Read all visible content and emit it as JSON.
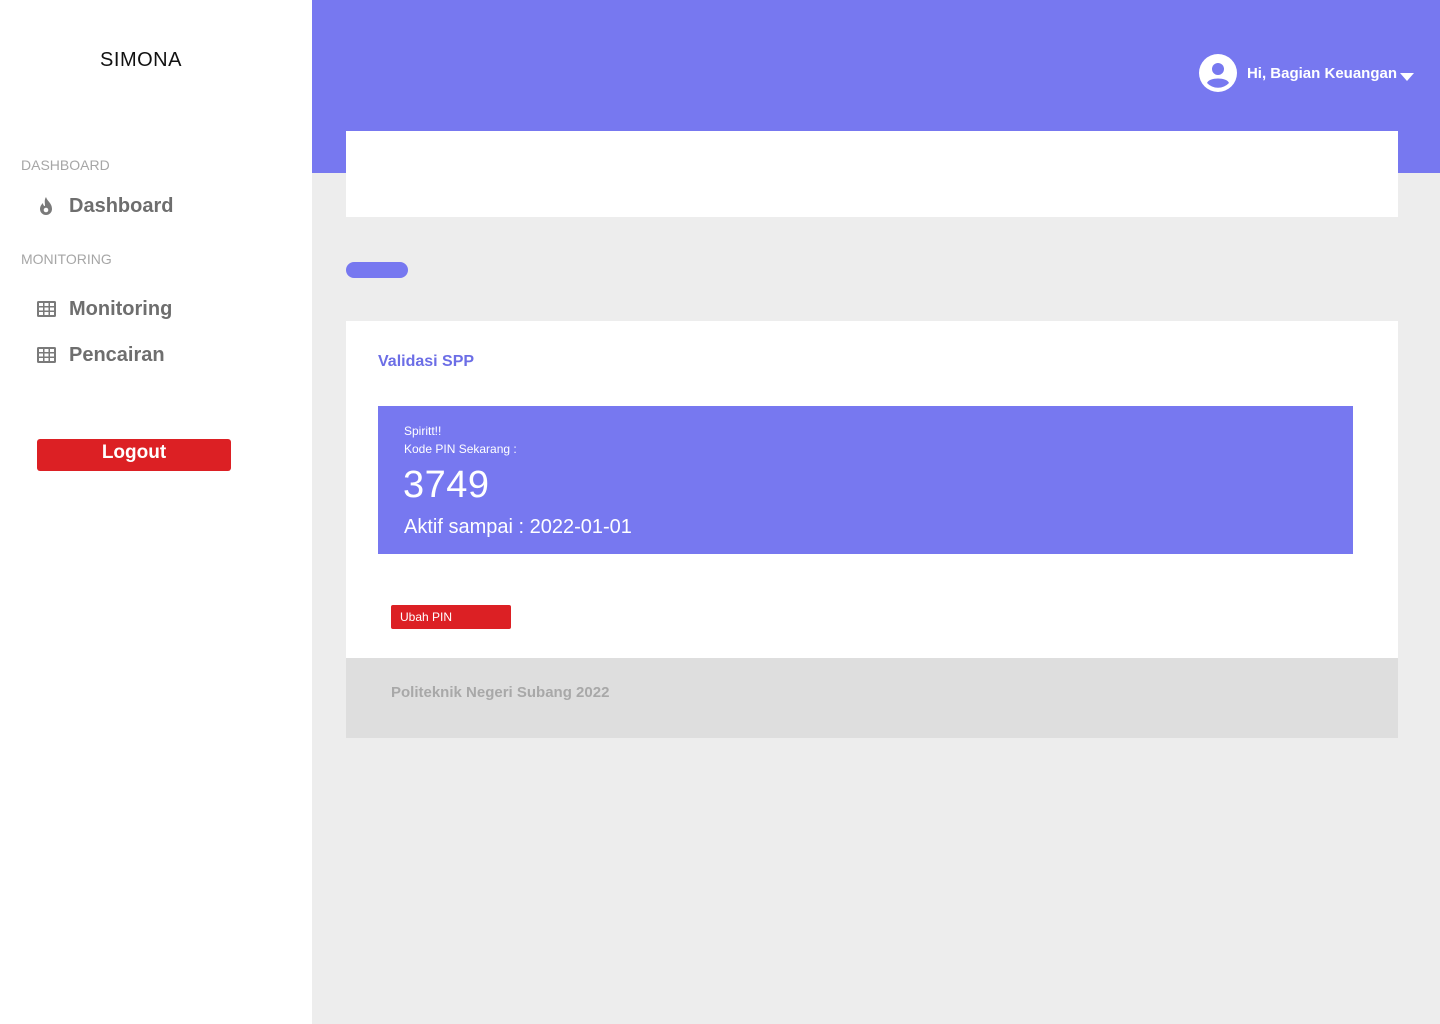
{
  "app": {
    "title": "SIMONA"
  },
  "sidebar": {
    "sections": [
      {
        "label": "DASHBOARD",
        "items": [
          {
            "label": "Dashboard",
            "icon": "fire-icon"
          }
        ]
      },
      {
        "label": "MONITORING",
        "items": [
          {
            "label": "Monitoring",
            "icon": "table-icon"
          },
          {
            "label": "Pencairan",
            "icon": "table-icon"
          }
        ]
      }
    ],
    "logout_label": "Logout"
  },
  "header": {
    "greeting": "Hi, Bagian Keuangan",
    "avatar_icon": "user-circle-icon",
    "dropdown_icon": "caret-down-icon"
  },
  "card": {
    "title": "Validasi SPP",
    "pin": {
      "line1": "Spiritt!!",
      "line2": "Kode PIN Sekarang :",
      "code": "3749",
      "active_until": "Aktif sampai : 2022-01-01"
    },
    "change_pin_label": "Ubah PIN"
  },
  "footer": {
    "text": "Politeknik Negeri Subang 2022"
  },
  "colors": {
    "accent": "#7778f0",
    "danger": "#dc2024",
    "background": "#ededed"
  }
}
